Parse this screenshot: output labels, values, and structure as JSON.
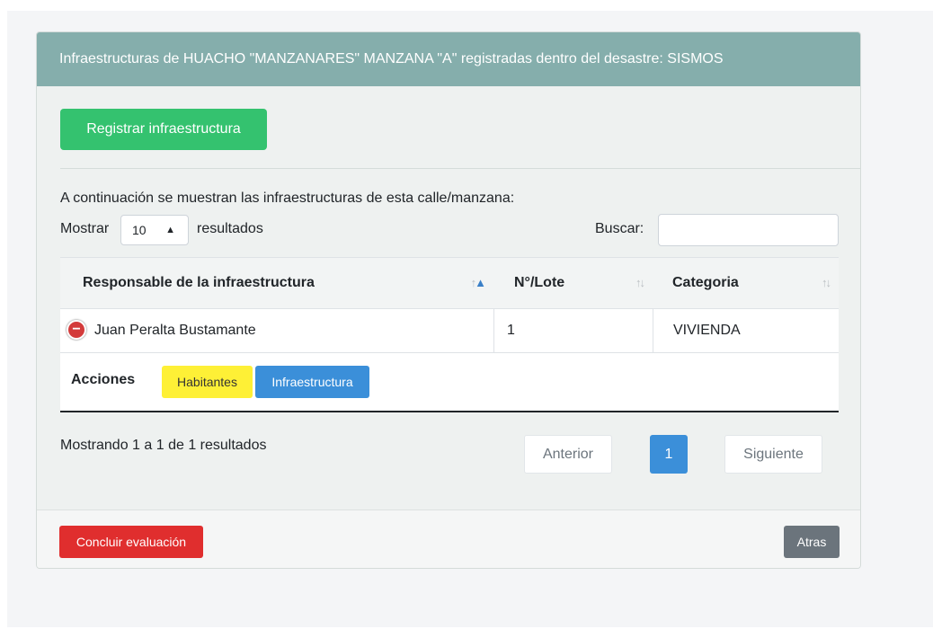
{
  "card": {
    "header_title": "Infraestructuras de HUACHO \"MANZANARES\" MANZANA \"A\" registradas dentro del desastre: SISMOS",
    "register_button": "Registrar infraestructura",
    "intro_text": "A continuación se muestran las infraestructuras de esta calle/manzana:"
  },
  "controls": {
    "show_label": "Mostrar",
    "page_length": "10",
    "results_label": "resultados",
    "search_label": "Buscar:",
    "search_value": ""
  },
  "table": {
    "columns": [
      "Responsable de la infraestructura",
      "N°/Lote",
      "Categoria"
    ],
    "rows": [
      {
        "responsable": "Juan Peralta Bustamante",
        "lote": "1",
        "categoria": "VIVIENDA"
      }
    ],
    "child": {
      "actions_label": "Acciones",
      "habitantes_button": "Habitantes",
      "infraestructura_button": "Infraestructura"
    },
    "sort_icon": "sort-arrows-icon",
    "expand_icon": "minus-circle-icon"
  },
  "pagination": {
    "info": "Mostrando 1 a 1 de 1 resultados",
    "previous": "Anterior",
    "current": "1",
    "next": "Siguiente"
  },
  "footer": {
    "conclude_button": "Concluir evaluación",
    "back_button": "Atras"
  },
  "colors": {
    "header": "#85aeac",
    "success": "#34c26f",
    "primary": "#3b8fd9",
    "warning": "#fef036",
    "danger": "#e02e2e",
    "secondary": "#6b747c"
  }
}
